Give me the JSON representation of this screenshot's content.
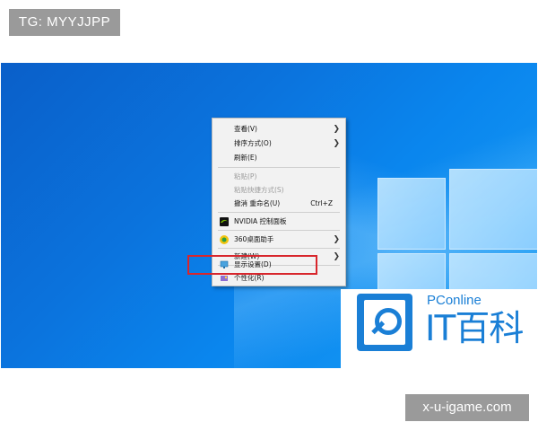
{
  "tag_badge": "TG: MYYJJPP",
  "site_badge": "x-u-igame.com",
  "menu": {
    "view": "查看(V)",
    "sort": "排序方式(O)",
    "refresh": "刷新(E)",
    "paste": "粘贴(P)",
    "paste_shortcut": "粘贴快捷方式(S)",
    "undo": "撤消 重命名(U)",
    "undo_shortcut": "Ctrl+Z",
    "nvidia": "NVIDIA 控制面板",
    "desktop360": "360桌面助手",
    "new": "新建(W)",
    "display": "显示设置(D)",
    "personalize": "个性化(R)"
  },
  "watermark": {
    "brand": "PConline",
    "text": "IT百科"
  },
  "icons": {
    "submenu_arrow": "chevron-right-icon",
    "nvidia": "nvidia-icon",
    "desktop360": "360-icon",
    "display": "display-settings-icon",
    "personalize": "personalize-icon"
  }
}
